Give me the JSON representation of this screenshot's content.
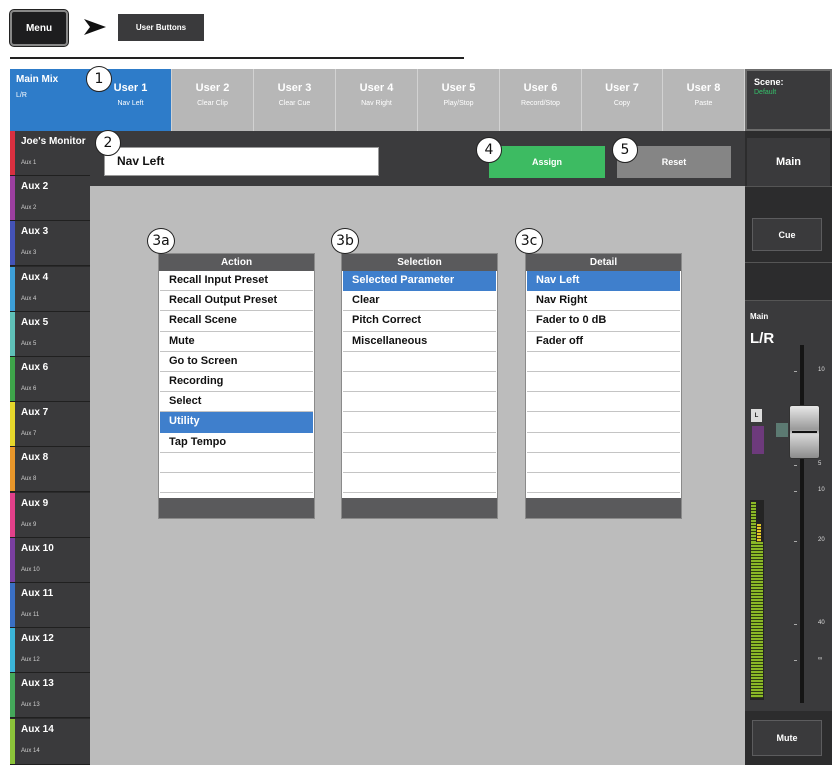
{
  "breadcrumb": {
    "menu_label": "Menu",
    "current_label": "User Buttons"
  },
  "main_mix": {
    "title": "Main Mix",
    "sub": "L/R"
  },
  "user_tabs": [
    {
      "label": "User 1",
      "sub": "Nav Left",
      "active": true
    },
    {
      "label": "User 2",
      "sub": "Clear Clip"
    },
    {
      "label": "User 3",
      "sub": "Clear Cue"
    },
    {
      "label": "User 4",
      "sub": "Nav Right"
    },
    {
      "label": "User 5",
      "sub": "Play/Stop"
    },
    {
      "label": "User 6",
      "sub": "Record/Stop"
    },
    {
      "label": "User 7",
      "sub": "Copy"
    },
    {
      "label": "User 8",
      "sub": "Paste"
    }
  ],
  "scene": {
    "label": "Scene:",
    "value": "Default"
  },
  "aux_list": [
    {
      "name": "Joe's Monitor",
      "sub": "Aux 1",
      "color": "#d93040"
    },
    {
      "name": "Aux 2",
      "sub": "Aux 2",
      "color": "#9c3fa0"
    },
    {
      "name": "Aux 3",
      "sub": "Aux 3",
      "color": "#4453b8"
    },
    {
      "name": "Aux 4",
      "sub": "Aux 4",
      "color": "#3d9fd8"
    },
    {
      "name": "Aux 5",
      "sub": "Aux 5",
      "color": "#5fc0b8"
    },
    {
      "name": "Aux 6",
      "sub": "Aux 6",
      "color": "#3ea54a"
    },
    {
      "name": "Aux 7",
      "sub": "Aux 7",
      "color": "#e5d62b"
    },
    {
      "name": "Aux 8",
      "sub": "Aux 8",
      "color": "#e8962a"
    },
    {
      "name": "Aux 9",
      "sub": "Aux 9",
      "color": "#e2408a"
    },
    {
      "name": "Aux 10",
      "sub": "Aux 10",
      "color": "#7a3fa0"
    },
    {
      "name": "Aux 11",
      "sub": "Aux 11",
      "color": "#3a6fc4"
    },
    {
      "name": "Aux 12",
      "sub": "Aux 12",
      "color": "#3bb4d8"
    },
    {
      "name": "Aux 13",
      "sub": "Aux 13",
      "color": "#44a85a"
    },
    {
      "name": "Aux 14",
      "sub": "Aux 14",
      "color": "#8cc43a"
    }
  ],
  "name_field": {
    "value": "Nav Left"
  },
  "buttons": {
    "assign": "Assign",
    "reset": "Reset"
  },
  "callouts": {
    "c1": "1",
    "c2": "2",
    "c3a": "3a",
    "c3b": "3b",
    "c3c": "3c",
    "c4": "4",
    "c5": "5"
  },
  "action_list": {
    "header": "Action",
    "items": [
      "Recall Input Preset",
      "Recall Output Preset",
      "Recall Scene",
      "Mute",
      "Go to Screen",
      "Recording",
      "Select",
      "Utility",
      "Tap Tempo",
      "",
      ""
    ],
    "selected_index": 7
  },
  "selection_list": {
    "header": "Selection",
    "items": [
      "Selected Parameter",
      "Clear",
      "Pitch Correct",
      "Miscellaneous",
      "",
      "",
      "",
      "",
      "",
      "",
      ""
    ],
    "selected_index": 0
  },
  "detail_list": {
    "header": "Detail",
    "items": [
      "Nav Left",
      "Nav Right",
      "Fader to 0 dB",
      "Fader off",
      "",
      "",
      "",
      "",
      "",
      "",
      ""
    ],
    "selected_index": 0
  },
  "right_panel": {
    "main_label": "Main",
    "cue_label": "Cue",
    "fader_title": "Main",
    "fader_sub": "L/R",
    "l_label": "L",
    "scale_labels": [
      "10",
      "5",
      "10",
      "20",
      "40",
      "∞"
    ],
    "mute_label": "Mute"
  }
}
